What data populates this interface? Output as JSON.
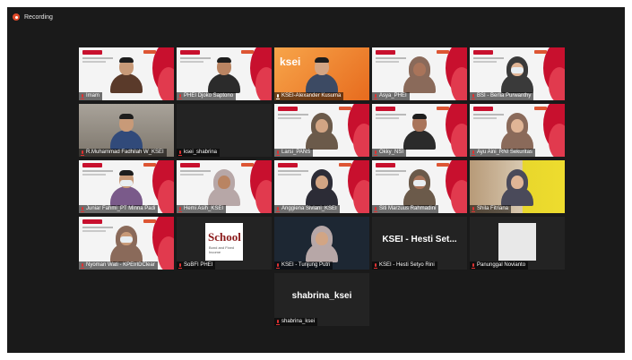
{
  "recording": {
    "label": "Recording"
  },
  "tiles": [
    {
      "name": "Imam",
      "type": "slide",
      "mic": "muted",
      "active": false
    },
    {
      "name": "PHEI Djoko Saptono",
      "type": "slide",
      "mic": "muted",
      "active": false
    },
    {
      "name": "KSEI-Alexander Kusuma",
      "type": "orange",
      "mic": "on",
      "active": false,
      "logo_text": "ksei"
    },
    {
      "name": "Asya_PHEI",
      "type": "slide",
      "mic": "muted",
      "active": true
    },
    {
      "name": "BSI - Berlia Purwanthy",
      "type": "slide",
      "mic": "muted",
      "active": false
    },
    {
      "name": "R.Muhammad Fadhilah W_KSEI",
      "type": "room",
      "mic": "muted",
      "active": false
    },
    {
      "name": "ksei_shabrina",
      "type": "blank",
      "mic": "muted",
      "active": false
    },
    {
      "name": "Larsi_PANS",
      "type": "slide",
      "mic": "muted",
      "active": false
    },
    {
      "name": "Okky_NSI",
      "type": "slide",
      "mic": "muted",
      "active": false
    },
    {
      "name": "Ayu Aini_RNI Sekuritas",
      "type": "slide",
      "mic": "muted",
      "active": false
    },
    {
      "name": "Juniar Fahmi_PT Minna Padi",
      "type": "slide",
      "mic": "muted",
      "active": false
    },
    {
      "name": "Hemi Asih_KSEI",
      "type": "slide",
      "mic": "muted",
      "active": false
    },
    {
      "name": "Anggiena Siviani_KSEI",
      "type": "slide",
      "mic": "muted",
      "active": false
    },
    {
      "name": "Siti Marzuus Rahmadini",
      "type": "slide",
      "mic": "muted",
      "active": false
    },
    {
      "name": "Shila Fitriana",
      "type": "yellow",
      "mic": "muted",
      "active": false
    },
    {
      "name": "Nyoman Wati - KPEI/IDClear",
      "type": "slide",
      "mic": "muted",
      "active": false
    },
    {
      "name": "SoBFI PHEI",
      "type": "school",
      "mic": "muted",
      "active": false,
      "logo_text": "School",
      "logo_sub": "Bond and Fixed Income"
    },
    {
      "name": "KSEI - Tunjung Putri",
      "type": "photo",
      "mic": "muted",
      "active": false
    },
    {
      "name": "KSEI - Hesti Setyo Rini",
      "type": "bigname",
      "mic": "muted",
      "active": false,
      "big_label": "KSEI - Hesti Set..."
    },
    {
      "name": "Panunggal Novianto",
      "type": "white",
      "mic": "muted",
      "active": false
    },
    {
      "name": "shabrina_ksei",
      "type": "bigname",
      "mic": "muted",
      "active": false,
      "big_label": "shabrina_ksei"
    }
  ],
  "colors": {
    "accent_red": "#c8102e",
    "active_border": "#e8d23a",
    "stage_bg": "#1a1a1a"
  }
}
